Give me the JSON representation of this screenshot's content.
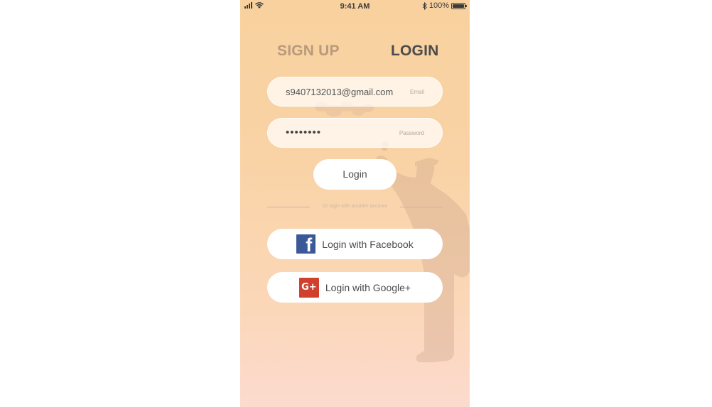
{
  "status_bar": {
    "time": "9:41 AM",
    "battery_text": "100%",
    "battery_level": 1.0
  },
  "tabs": {
    "signup": "SIGN UP",
    "login": "LOGIN",
    "active": "login"
  },
  "form": {
    "email_value": "s9407132013@gmail.com",
    "email_label": "Email",
    "password_value": "••••••••",
    "password_label": "Password",
    "submit_label": "Login"
  },
  "divider_text": "Or login with another account",
  "social": {
    "facebook_label": "Login with Facebook",
    "google_label": "Login with Google+"
  },
  "icons": {
    "facebook": "facebook-logo-icon",
    "google": "google-plus-logo-icon",
    "signal": "cellular-signal-icon",
    "wifi": "wifi-icon",
    "bluetooth": "bluetooth-icon",
    "battery": "battery-icon"
  },
  "colors": {
    "facebook": "#3b5998",
    "google": "#d0402e",
    "active_tab": "#4b4b4b",
    "inactive_tab": "#b99a7c"
  }
}
